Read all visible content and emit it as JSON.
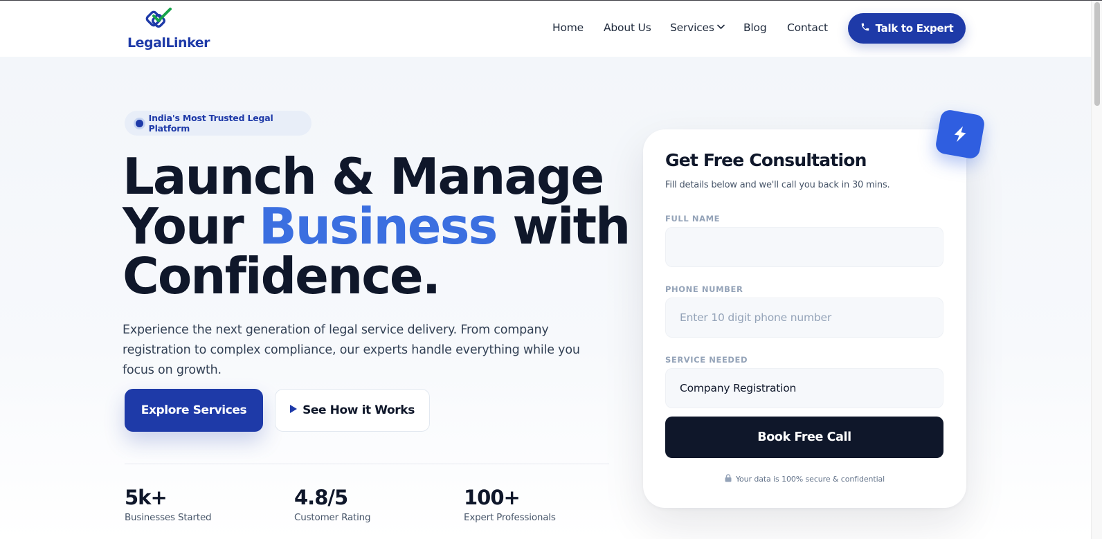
{
  "header": {
    "logo_text": "LegalLinker",
    "nav": [
      {
        "label": "Home"
      },
      {
        "label": "About Us"
      },
      {
        "label": "Services",
        "has_dropdown": true
      },
      {
        "label": "Blog"
      },
      {
        "label": "Contact"
      }
    ],
    "cta_label": "Talk to Expert",
    "cta_icon": "phone-icon"
  },
  "hero": {
    "badge": "India's Most Trusted Legal Platform",
    "headline": {
      "line1": "Launch & Manage",
      "line2_pre": "Your ",
      "line2_accent": "Business",
      "line2_post": " with",
      "line3": "Confidence."
    },
    "subtext": "Experience the next generation of legal service delivery. From company registration to complex compliance, our experts handle everything while you focus on growth.",
    "primary_button": "Explore Services",
    "secondary_button": "See How it Works",
    "stats": [
      {
        "value": "5k+",
        "label": "Businesses Started"
      },
      {
        "value": "4.8/5",
        "label": "Customer Rating"
      },
      {
        "value": "100+",
        "label": "Expert Professionals"
      }
    ]
  },
  "form": {
    "title": "Get Free Consultation",
    "subtitle": "Fill details below and we'll call you back in 30 mins.",
    "full_name_label": "FULL NAME",
    "full_name_value": "",
    "phone_label": "PHONE NUMBER",
    "phone_placeholder": "Enter 10 digit phone number",
    "service_label": "SERVICE NEEDED",
    "service_value": "Company Registration",
    "submit_label": "Book Free Call",
    "security_note": "Your data is 100% secure & confidential"
  },
  "colors": {
    "brand": "#1e3aa8",
    "accent": "#3b6fe0",
    "dark": "#0f172a",
    "logo_check": "#16a34a"
  }
}
